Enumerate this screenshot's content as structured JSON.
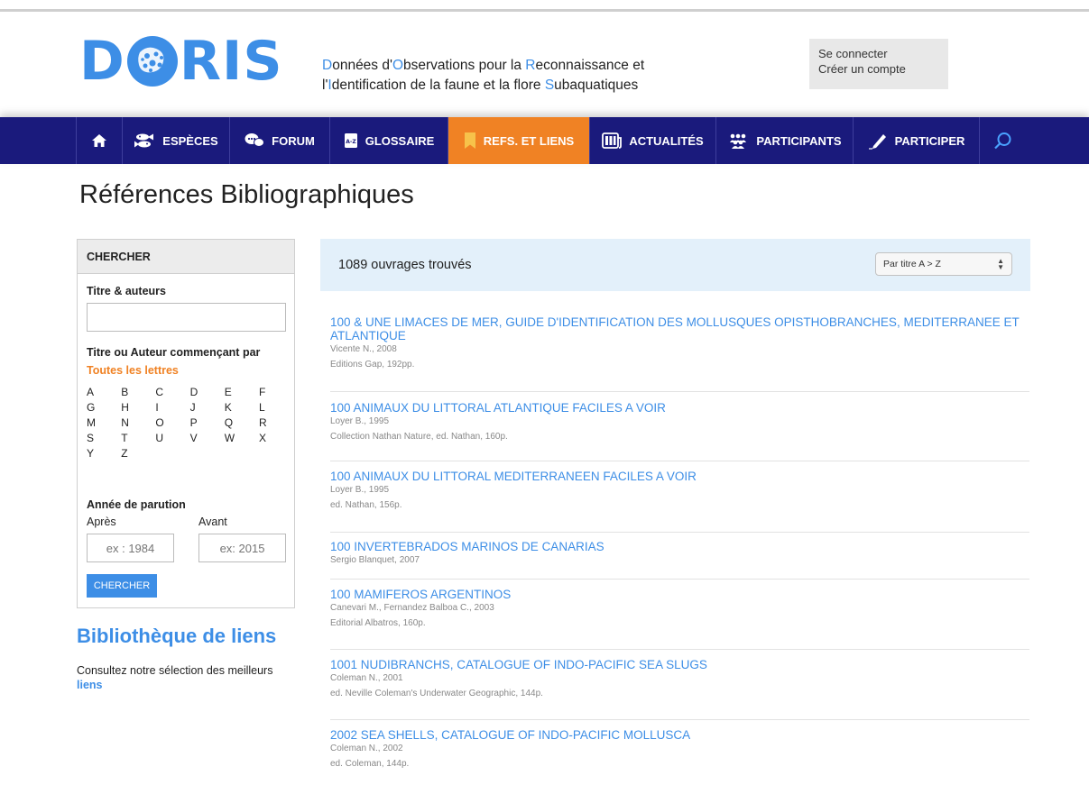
{
  "header": {
    "logo_left": "D",
    "logo_right": "RIS",
    "tagline": [
      [
        {
          "t": "D",
          "h": true
        },
        {
          "t": "onnées d'",
          "h": false
        },
        {
          "t": "O",
          "h": true
        },
        {
          "t": "bservations pour la ",
          "h": false
        },
        {
          "t": "R",
          "h": true
        },
        {
          "t": "econnaissance et",
          "h": false
        }
      ],
      [
        {
          "t": "l'",
          "h": false
        },
        {
          "t": "I",
          "h": true
        },
        {
          "t": "dentification de la faune et la flore ",
          "h": false
        },
        {
          "t": "S",
          "h": true
        },
        {
          "t": "ubaquatiques",
          "h": false
        }
      ]
    ],
    "login": "Se connecter",
    "register": "Créer un compte"
  },
  "nav": {
    "items": [
      {
        "label": "",
        "icon": "home-icon"
      },
      {
        "label": "ESPÈCES",
        "icon": "fish-icon"
      },
      {
        "label": "FORUM",
        "icon": "chat-icon"
      },
      {
        "label": "GLOSSAIRE",
        "icon": "glossary-icon"
      },
      {
        "label": "REFS. ET LIENS",
        "icon": "bookmark-icon",
        "active": true
      },
      {
        "label": "ACTUALITÉS",
        "icon": "news-icon"
      },
      {
        "label": "PARTICIPANTS",
        "icon": "people-icon"
      },
      {
        "label": "PARTICIPER",
        "icon": "pencil-icon"
      },
      {
        "label": "",
        "icon": "search-icon"
      }
    ]
  },
  "page": {
    "title": "Références Bibliographiques"
  },
  "search": {
    "heading": "CHERCHER",
    "title_authors_label": "Titre & auteurs",
    "starts_with_label": "Titre ou Auteur commençant par",
    "all_letters": "Toutes les lettres",
    "letters": [
      "A",
      "B",
      "C",
      "D",
      "E",
      "F",
      "G",
      "H",
      "I",
      "J",
      "K",
      "L",
      "M",
      "N",
      "O",
      "P",
      "Q",
      "R",
      "S",
      "T",
      "U",
      "V",
      "W",
      "X",
      "Y",
      "Z"
    ],
    "year_label": "Année de parution",
    "after_label": "Après",
    "before_label": "Avant",
    "after_placeholder": "ex : 1984",
    "before_placeholder": "ex: 2015",
    "button": "CHERCHER"
  },
  "library": {
    "title": "Bibliothèque de liens",
    "text": "Consultez notre sélection des meilleurs",
    "link": "liens"
  },
  "results": {
    "count": "1089 ouvrages trouvés",
    "sort": "Par titre A > Z",
    "items": [
      {
        "title": "100 & UNE LIMACES DE MER, GUIDE D'IDENTIFICATION DES MOLLUSQUES OPISTHOBRANCHES, MEDITERRANEE ET ATLANTIQUE",
        "author": "Vicente N., 2008",
        "publisher": "Editions Gap, 192pp."
      },
      {
        "title": "100 ANIMAUX DU LITTORAL ATLANTIQUE FACILES A VOIR",
        "author": "Loyer B., 1995",
        "publisher": "Collection Nathan Nature, ed. Nathan, 160p."
      },
      {
        "title": "100 ANIMAUX DU LITTORAL MEDITERRANEEN FACILES A VOIR",
        "author": "Loyer B., 1995",
        "publisher": "ed. Nathan, 156p."
      },
      {
        "title": "100 INVERTEBRADOS MARINOS DE CANARIAS",
        "author": "Sergio Blanquet, 2007",
        "publisher": ""
      },
      {
        "title": "100 MAMIFEROS ARGENTINOS",
        "author": "Canevari M., Fernandez Balboa C., 2003",
        "publisher": "Editorial Albatros, 160p."
      },
      {
        "title": "1001 NUDIBRANCHS, CATALOGUE OF INDO-PACIFIC SEA SLUGS",
        "author": "Coleman N., 2001",
        "publisher": "ed. Neville Coleman's Underwater Geographic, 144p."
      },
      {
        "title": "2002 SEA SHELLS, CATALOGUE OF INDO-PACIFIC MOLLUSCA",
        "author": "Coleman N., 2002",
        "publisher": "ed. Coleman, 144p."
      }
    ]
  },
  "colors": {
    "accent": "#3d8ee6",
    "nav": "#1a1a7c",
    "active": "#f08224",
    "results_bar": "#e3f0fa"
  }
}
